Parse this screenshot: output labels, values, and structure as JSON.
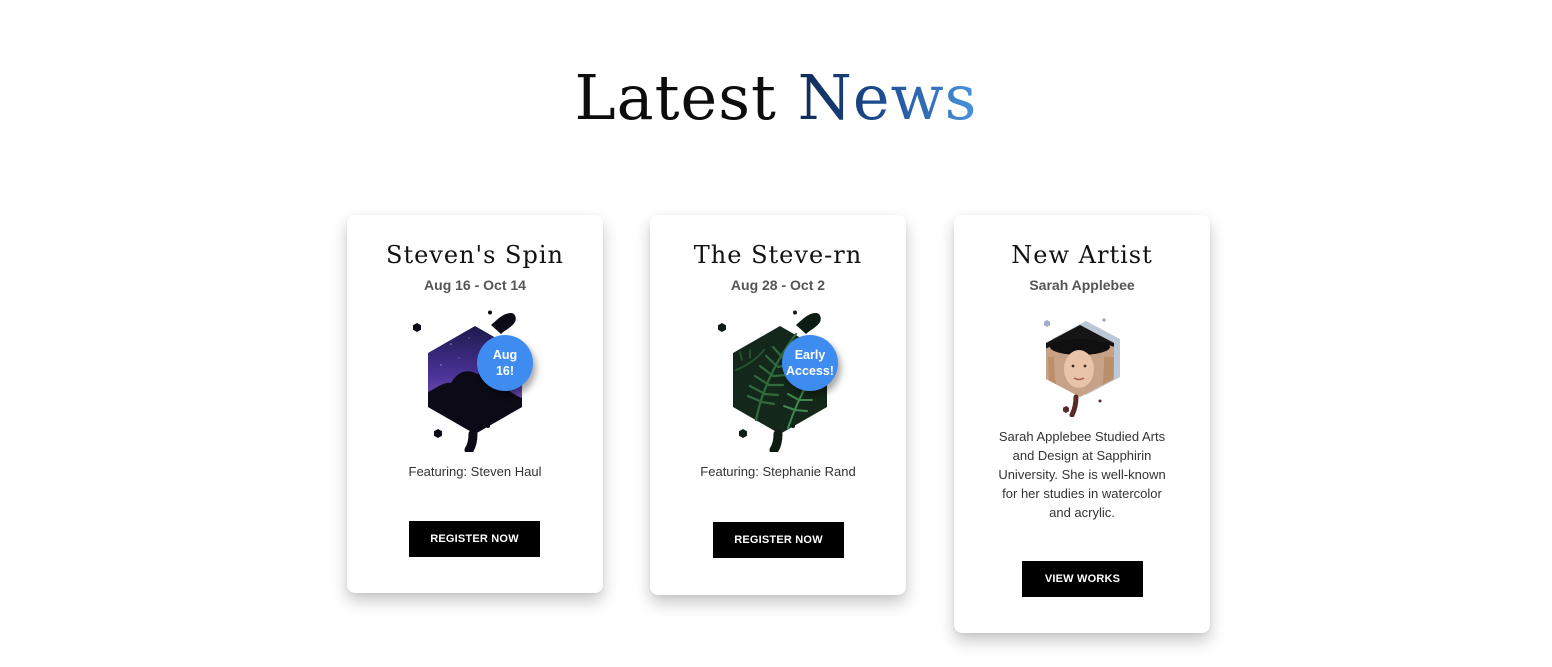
{
  "section": {
    "title_main": "Latest ",
    "title_accent": "News"
  },
  "cards": [
    {
      "title": "Steven's Spin",
      "subtitle": "Aug 16 - Oct 14",
      "badge_line1": "Aug",
      "badge_line2": "16!",
      "image": "starry-night-sky-with-tree",
      "featuring": "Featuring: Steven Haul",
      "button": "REGISTER NOW"
    },
    {
      "title": "The Steve-rn",
      "subtitle": "Aug 28 - Oct 2",
      "badge_line1": "Early",
      "badge_line2": "Access!",
      "image": "green-fern-leaves",
      "featuring": "Featuring: Stephanie Rand",
      "button": "REGISTER NOW"
    },
    {
      "title": "New Artist",
      "subtitle": "Sarah Applebee",
      "image": "artist-portrait",
      "description": "Sarah Applebee Studied Arts and Design at Sapphirin University. She is well-known for her studies in watercolor and acrylic.",
      "button": "VIEW WORKS"
    }
  ],
  "colors": {
    "badge": "#3f8cf0",
    "button": "#000000",
    "accent_start": "#0f2a55",
    "accent_end": "#4b94e0"
  }
}
